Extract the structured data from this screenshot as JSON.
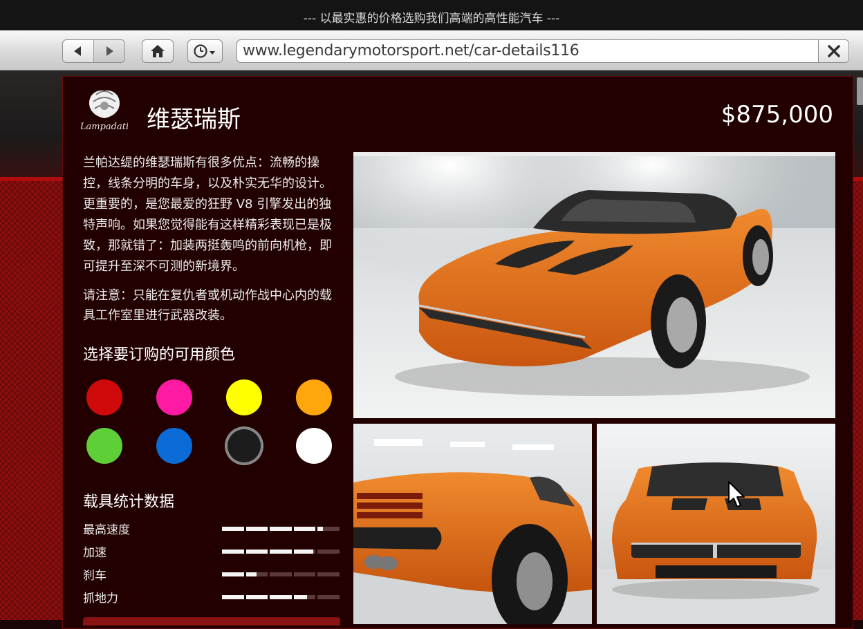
{
  "banner": {
    "text": "--- 以最实惠的价格选购我们高端的高性能汽车 ---"
  },
  "browser": {
    "url": "www.legendarymotorsport.net/car-details116"
  },
  "vehicle": {
    "brand_logo_text": "Lampadati",
    "name": "维瑟瑞斯",
    "price": "$875,000",
    "description": "兰帕达缇的维瑟瑞斯有很多优点：流畅的操控，线条分明的车身，以及朴实无华的设计。更重要的，是您最爱的狂野 V8 引擎发出的独特声响。如果您觉得能有这样精彩表现已是极致，那就错了：加装两挺轰鸣的前向机枪，即可提升至深不可测的新境界。",
    "note": "请注意：只能在复仇者或机动作战中心内的载具工作室里进行武器改装。"
  },
  "color_section": {
    "title": "选择要订购的可用颜色",
    "swatches": [
      {
        "name": "red",
        "hex": "#d00a0a"
      },
      {
        "name": "pink",
        "hex": "#ff1aa3"
      },
      {
        "name": "yellow",
        "hex": "#ffff00"
      },
      {
        "name": "orange",
        "hex": "#ffa60d"
      },
      {
        "name": "green",
        "hex": "#5fcf38"
      },
      {
        "name": "blue",
        "hex": "#0a6bd6"
      },
      {
        "name": "black",
        "hex": "#1c1c1c",
        "selected": true
      },
      {
        "name": "white",
        "hex": "#ffffff"
      }
    ]
  },
  "stats_section": {
    "title": "载具统计数据",
    "stats": [
      {
        "label": "最高速度",
        "level": 0.85
      },
      {
        "label": "加速",
        "level": 0.78
      },
      {
        "label": "刹车",
        "level": 0.3
      },
      {
        "label": "抓地力",
        "level": 0.72
      }
    ]
  },
  "colors": {
    "panel_bg": "#220000",
    "accent_red": "#b10d0d",
    "car_body": "#e8731c"
  },
  "icons": {
    "back": "arrow-left-icon",
    "forward": "arrow-right-icon",
    "home": "home-icon",
    "history": "clock-icon",
    "close": "close-x-icon"
  }
}
